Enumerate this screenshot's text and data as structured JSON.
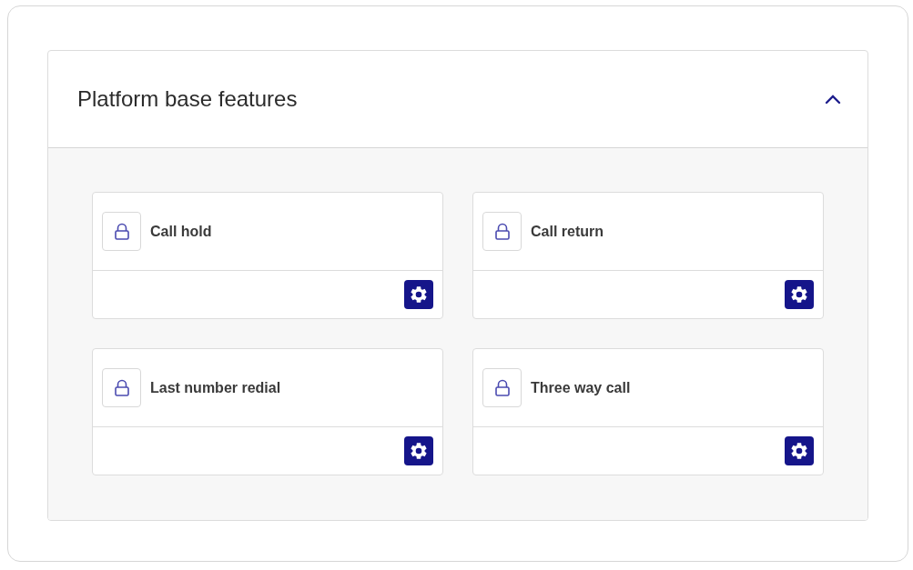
{
  "section": {
    "title": "Platform base features",
    "expanded": true
  },
  "features": [
    {
      "name": "Call hold"
    },
    {
      "name": "Call return"
    },
    {
      "name": "Last number redial"
    },
    {
      "name": "Three way call"
    }
  ]
}
